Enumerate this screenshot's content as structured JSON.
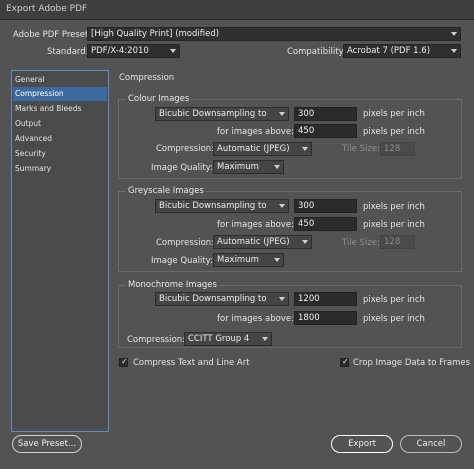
{
  "window": {
    "title": "Export Adobe PDF"
  },
  "header": {
    "preset_label": "Adobe PDF Preset:",
    "preset_value": "[High Quality Print] (modified)",
    "standard_label": "Standard:",
    "standard_value": "PDF/X-4:2010",
    "compatibility_label": "Compatibility:",
    "compatibility_value": "Acrobat 7 (PDF 1.6)"
  },
  "sidebar": {
    "items": [
      {
        "label": "General"
      },
      {
        "label": "Compression"
      },
      {
        "label": "Marks and Bleeds"
      },
      {
        "label": "Output"
      },
      {
        "label": "Advanced"
      },
      {
        "label": "Security"
      },
      {
        "label": "Summary"
      }
    ]
  },
  "main": {
    "heading": "Compression",
    "colour": {
      "title": "Colour Images",
      "sampling": "Bicubic Downsampling to",
      "ppi": "300",
      "ppi_unit": "pixels per inch",
      "above_label": "for images above:",
      "above": "450",
      "above_unit": "pixels per inch",
      "compression_label": "Compression:",
      "compression": "Automatic (JPEG)",
      "tile_label": "Tile Size:",
      "tile": "128",
      "quality_label": "Image Quality:",
      "quality": "Maximum"
    },
    "greyscale": {
      "title": "Greyscale Images",
      "sampling": "Bicubic Downsampling to",
      "ppi": "300",
      "ppi_unit": "pixels per inch",
      "above_label": "for images above:",
      "above": "450",
      "above_unit": "pixels per inch",
      "compression_label": "Compression:",
      "compression": "Automatic (JPEG)",
      "tile_label": "Tile Size:",
      "tile": "128",
      "quality_label": "Image Quality:",
      "quality": "Maximum"
    },
    "monochrome": {
      "title": "Monochrome Images",
      "sampling": "Bicubic Downsampling to",
      "ppi": "1200",
      "ppi_unit": "pixels per inch",
      "above_label": "for images above:",
      "above": "1800",
      "above_unit": "pixels per inch",
      "compression_label": "Compression:",
      "compression": "CCITT Group 4"
    },
    "compress_text": {
      "label": "Compress Text and Line Art",
      "checked": true
    },
    "crop_image": {
      "label": "Crop Image Data to Frames",
      "checked": true
    }
  },
  "footer": {
    "save_preset": "Save Preset...",
    "export": "Export",
    "cancel": "Cancel"
  }
}
